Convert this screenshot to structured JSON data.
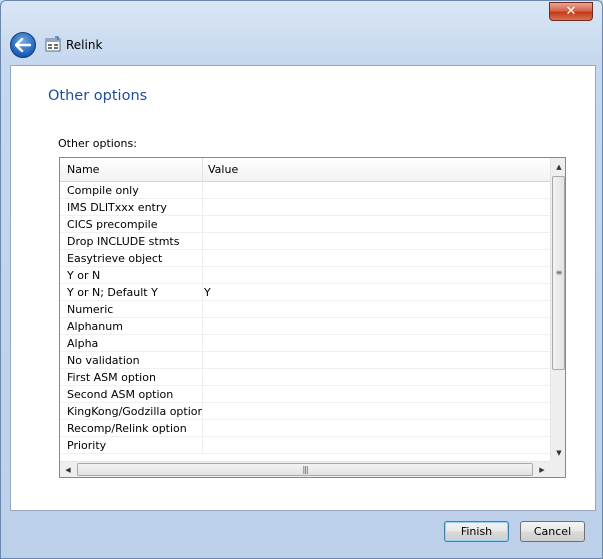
{
  "window": {
    "title": "Relink",
    "close_glyph": "✕"
  },
  "page": {
    "title": "Other options",
    "section_label": "Other options:"
  },
  "table": {
    "columns": [
      "Name",
      "Value"
    ],
    "rows": [
      {
        "name": "Compile only",
        "value": ""
      },
      {
        "name": "IMS DLITxxx entry",
        "value": ""
      },
      {
        "name": "CICS precompile",
        "value": ""
      },
      {
        "name": "Drop INCLUDE stmts",
        "value": ""
      },
      {
        "name": "Easytrieve object",
        "value": ""
      },
      {
        "name": "Y or N",
        "value": ""
      },
      {
        "name": "Y or N; Default Y",
        "value": "Y"
      },
      {
        "name": "Numeric",
        "value": ""
      },
      {
        "name": "Alphanum",
        "value": ""
      },
      {
        "name": "Alpha",
        "value": ""
      },
      {
        "name": "No validation",
        "value": ""
      },
      {
        "name": "First ASM option",
        "value": ""
      },
      {
        "name": "Second ASM option",
        "value": ""
      },
      {
        "name": "KingKong/Godzilla option",
        "value": ""
      },
      {
        "name": "Recomp/Relink option",
        "value": ""
      },
      {
        "name": "Priority",
        "value": ""
      }
    ]
  },
  "buttons": {
    "finish": "Finish",
    "cancel": "Cancel"
  },
  "icons": {
    "back": "back-arrow-icon",
    "app": "relink-app-icon"
  },
  "colors": {
    "title_blue": "#1e4e9a",
    "close_red": "#c23c1c"
  }
}
